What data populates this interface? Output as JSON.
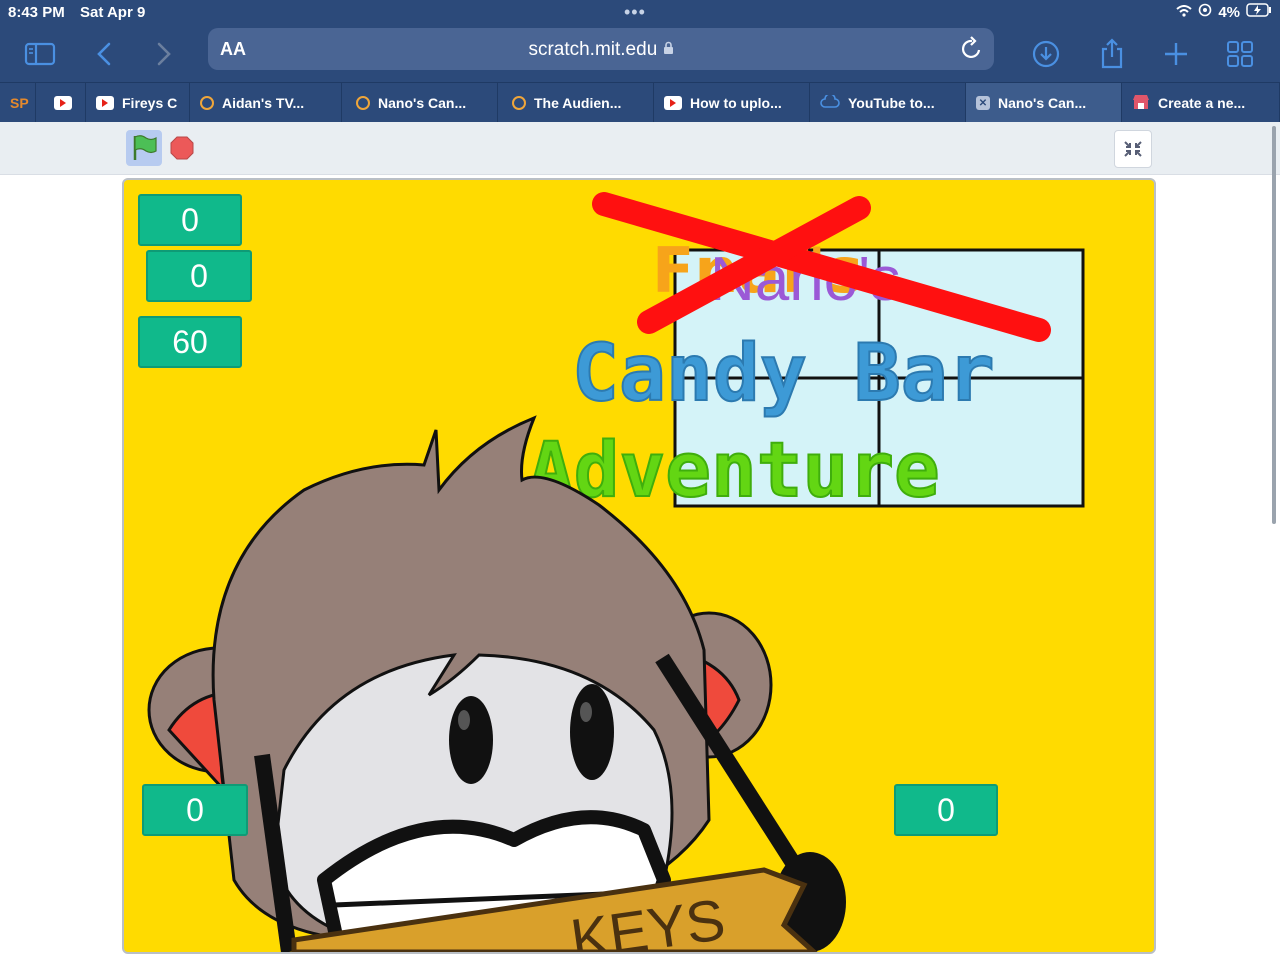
{
  "status": {
    "time": "8:43 PM",
    "date": "Sat Apr 9",
    "battery": "4%"
  },
  "browser": {
    "text_size_label": "AA",
    "url": "scratch.mit.edu",
    "tabs": [
      {
        "label": "SP",
        "icon": "sp-icon"
      },
      {
        "label": "",
        "icon": "youtube-icon"
      },
      {
        "label": "Fireys C",
        "icon": "youtube-icon"
      },
      {
        "label": "Aidan's TV...",
        "icon": "scratch-icon"
      },
      {
        "label": "Nano's Can...",
        "icon": "scratch-icon"
      },
      {
        "label": "The Audien...",
        "icon": "scratch-icon"
      },
      {
        "label": "How to uplo...",
        "icon": "youtube-icon"
      },
      {
        "label": "YouTube to...",
        "icon": "cloud-icon"
      },
      {
        "label": "Nano's Can...",
        "icon": "x-icon",
        "active": true
      },
      {
        "label": "Create a ne...",
        "icon": "store-icon"
      }
    ]
  },
  "stage": {
    "monitors": {
      "top1": "0",
      "top2": "0",
      "top3": "60",
      "bottom_left": "0",
      "bottom_right": "0"
    },
    "title": {
      "crossed_out": "Fnaf's",
      "name": "Nano's",
      "line1": "Candy Bar",
      "line2": "Adventure"
    },
    "sign_text": "KEYS"
  },
  "colors": {
    "chrome": "#2c4a7a",
    "stage_bg": "#ffdb00",
    "monitor": "#10b98b"
  }
}
